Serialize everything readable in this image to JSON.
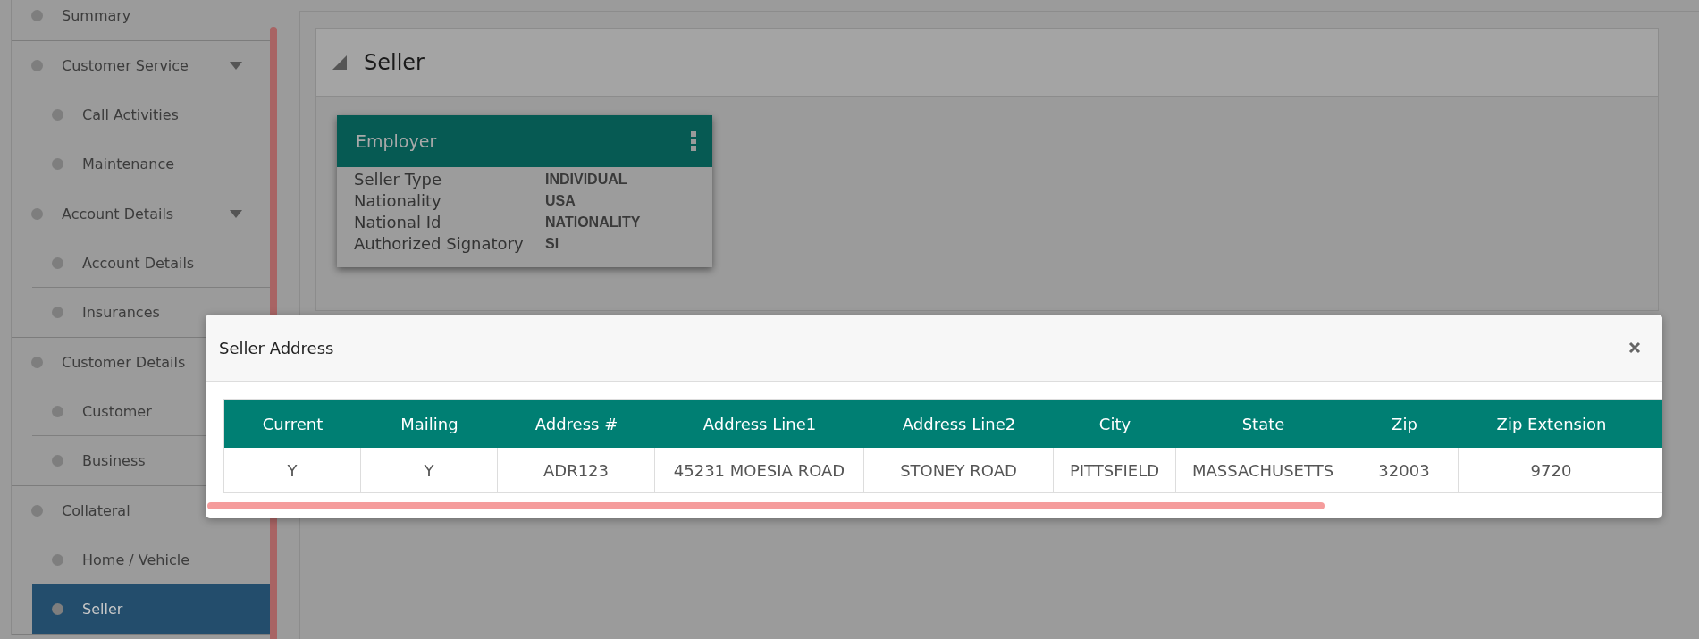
{
  "sidebar": {
    "items": [
      {
        "label": "Summary",
        "selected": false
      },
      {
        "label": "Customer Service",
        "selected": false,
        "expanded": true,
        "children": [
          {
            "label": "Call Activities",
            "selected": false
          },
          {
            "label": "Maintenance",
            "selected": false
          }
        ]
      },
      {
        "label": "Account Details",
        "selected": false,
        "expanded": true,
        "children": [
          {
            "label": "Account Details",
            "selected": false
          },
          {
            "label": "Insurances",
            "selected": false
          }
        ]
      },
      {
        "label": "Customer Details",
        "selected": false,
        "expanded": true,
        "children": [
          {
            "label": "Customer",
            "selected": false
          },
          {
            "label": "Business",
            "selected": false
          }
        ]
      },
      {
        "label": "Collateral",
        "selected": false,
        "expanded": true,
        "children": [
          {
            "label": "Home / Vehicle",
            "selected": false
          },
          {
            "label": "Seller",
            "selected": true
          }
        ]
      }
    ]
  },
  "section": {
    "title": "Seller",
    "expanded": true,
    "card": {
      "title": "Employer",
      "fields": [
        {
          "label": "Seller Type",
          "value": "INDIVIDUAL"
        },
        {
          "label": "Nationality",
          "value": "USA"
        },
        {
          "label": "National Id",
          "value": "NATIONALITY"
        },
        {
          "label": "Authorized Signatory",
          "value": "SI"
        }
      ]
    }
  },
  "dialog": {
    "title": "Seller Address",
    "table": {
      "columns": [
        "Current",
        "Mailing",
        "Address #",
        "Address Line1",
        "Address Line2",
        "City",
        "State",
        "Zip",
        "Zip Extension"
      ],
      "rows": [
        [
          "Y",
          "Y",
          "ADR123",
          "45231 MOESIA ROAD",
          "STONEY ROAD",
          "PITTSFIELD",
          "MASSACHUSETTS",
          "32003",
          "9720"
        ]
      ]
    }
  }
}
